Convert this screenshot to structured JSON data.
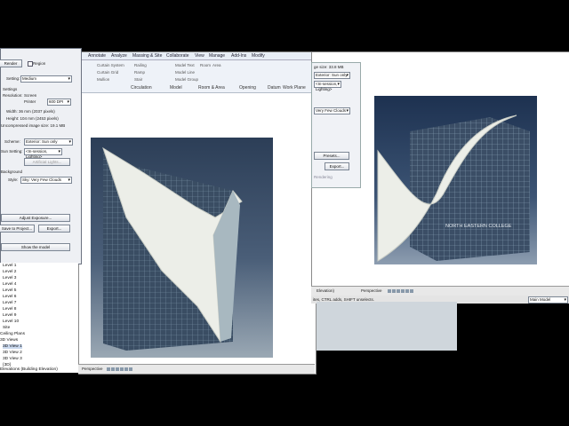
{
  "ribbon": {
    "tabs": [
      "Annotate",
      "Analyze",
      "Massing & Site",
      "Collaborate",
      "View",
      "Manage",
      "Add-Ins",
      "Modify"
    ],
    "items": [
      "Curtain System",
      "Curtain Grid",
      "Mullion",
      "Railing",
      "Ramp",
      "Stair",
      "Model Text",
      "Model Line",
      "Model Group",
      "Room",
      "Area"
    ],
    "groups": [
      "Circulation",
      "Model",
      "Room & Area",
      "Opening",
      "Datum",
      "Work Plane"
    ]
  },
  "dialog": {
    "render_label": "Render",
    "region_label": "Region",
    "setting_label": "Setting:",
    "setting_value": "Medium",
    "output_settings": "Settings",
    "resolution_label": "Resolution:",
    "screen_label": "Screen",
    "printer_label": "Printer",
    "dpi_value": "600 DPI",
    "width_text": "Width: 36 mm (2037 pixels)",
    "height_text": "Height: 104 mm (2453 pixels)",
    "image_size_text": "Uncompressed image size: 19.1 MB",
    "scheme_label": "Scheme:",
    "scheme_value": "Exterior: Sun only",
    "sun_setting_label": "Sun Setting:",
    "sun_setting_value": "<In-session, Lighting>",
    "artificial_lights": "Artificial Lights...",
    "background_label": "Background",
    "style_label": "Style:",
    "style_value": "Sky: Very Few Clouds",
    "adjust_exposure": "Adjust Exposure...",
    "save_to_project": "Save to Project...",
    "export": "Export...",
    "show_model": "Show the model"
  },
  "browser": {
    "items": [
      "Level 1",
      "Level 2",
      "Level 3",
      "Level 4",
      "Level 5",
      "Level 6",
      "Level 7",
      "Level 8",
      "Level 9",
      "Level 10",
      "Site",
      "Ceiling Plans",
      "3D Views",
      "3D View 1",
      "3D View 2",
      "3D View 3",
      "{3D}",
      "Elevations (Building Elevation)"
    ]
  },
  "win2": {
    "scheme_value": "Exterior: Sun only",
    "image_size": "ge size: 33.8 MB",
    "sun_value": "<In-session, Lighting>",
    "style_value": "Very Few Clouds",
    "export": "Export...",
    "rendering": "Rendering",
    "presets": "Presets...",
    "college_text": "NORTH EASTERN COLLEGE",
    "view_label": "Perspective",
    "elevation_label": "Elevation)",
    "status_text": "ites, CTRL adds, SHIFT unselects.",
    "main_model": "Main Model"
  },
  "view1": {
    "view_label": "Perspective"
  }
}
